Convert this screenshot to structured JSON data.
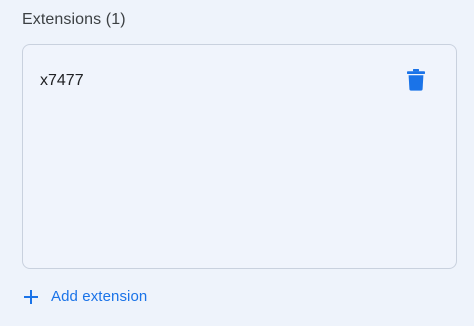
{
  "section": {
    "title": "Extensions (1)"
  },
  "extensions": [
    {
      "name": "x7477",
      "delete_icon": "trash-icon"
    }
  ],
  "add_button": {
    "icon": "plus-icon",
    "label": "Add extension"
  },
  "colors": {
    "background": "#eef3fb",
    "card_border": "#c9d1de",
    "accent": "#1a73e8",
    "delete_icon": "#1a73e8"
  }
}
